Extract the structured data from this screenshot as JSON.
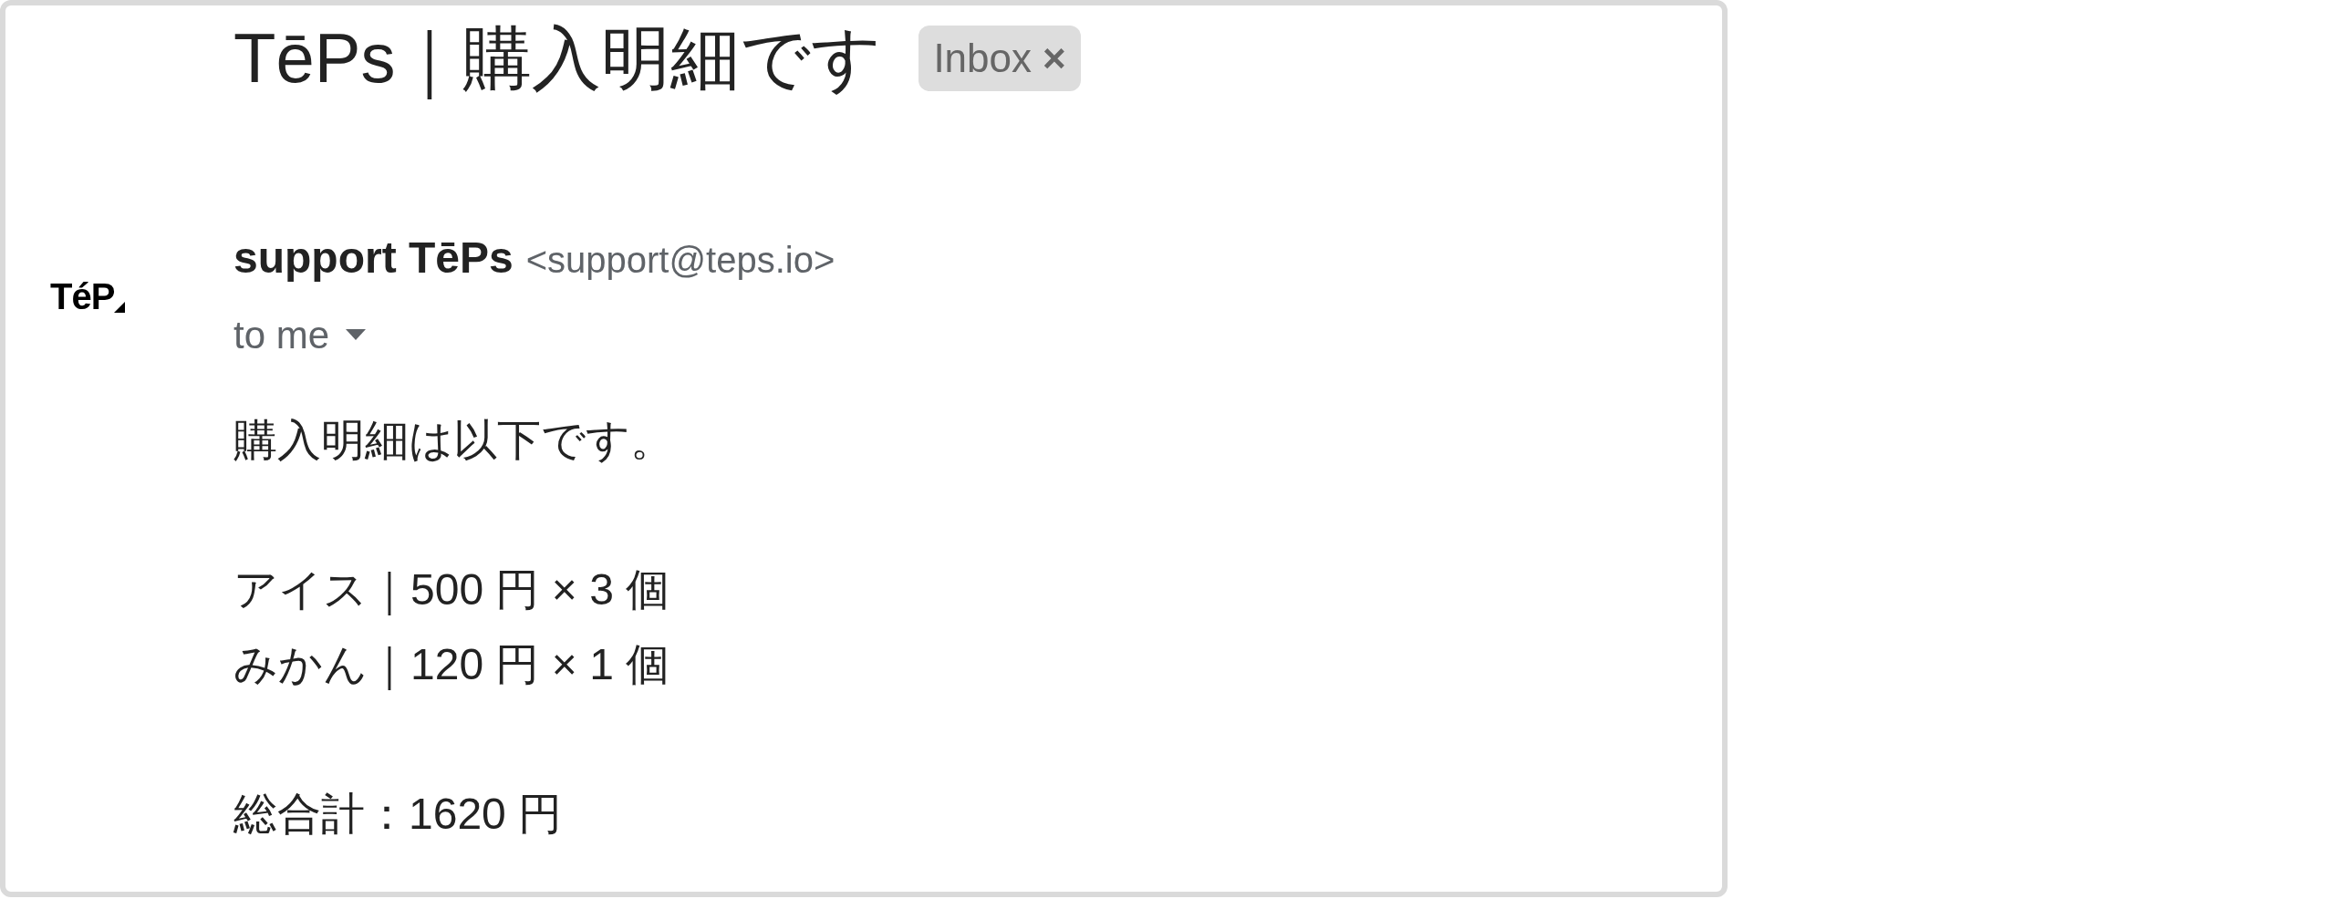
{
  "subject": {
    "title": "TēPs｜購入明細です",
    "label": {
      "text": "Inbox",
      "remove": "×"
    }
  },
  "sender": {
    "logo": "TéP",
    "name": "support TēPs",
    "email": "<support@teps.io>",
    "recipient": "to me"
  },
  "body": [
    [
      "購入明細は以下です。"
    ],
    [
      "アイス｜500 円 × 3 個",
      "みかん｜120 円 × 1 個"
    ],
    [
      "総合計：1620 円"
    ]
  ]
}
